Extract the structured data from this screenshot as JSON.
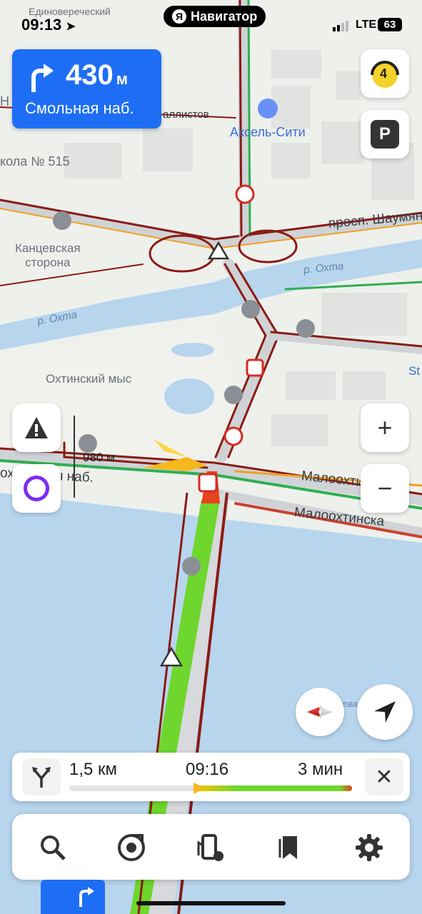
{
  "status_bar": {
    "time": "09:13",
    "network": "LTE",
    "battery": "63"
  },
  "app_pill": {
    "logo": "Я",
    "title": "Навигатор"
  },
  "maneuver": {
    "distance": "430",
    "unit": "м",
    "street": "Смольная наб."
  },
  "map_labels": {
    "district_top": "Единовереческий",
    "school": "кола № 515",
    "street_top": "аллистов",
    "poi": "Аксель-Сити",
    "district": "Канцевская\nсторона",
    "avenue": "просп. Шаумян",
    "river_right": "р. Охта",
    "river_left": "р. Охта",
    "cape": "Охтинский мыс",
    "embankment_left": "охтинская наб.",
    "embankment_right_1": "Малоохтинск",
    "embankment_right_2": "Малоохтинска",
    "distance_marker": "980 м",
    "letter_n": "Н",
    "st_label": "St",
    "nev_label": "Нева"
  },
  "controls": {
    "speed_limit": "4",
    "parking": "P"
  },
  "route": {
    "distance": "1,5 км",
    "arrival": "09:16",
    "duration": "3 мин",
    "progress_fraction": 0.46
  },
  "icons": {
    "close": "close-icon",
    "search": "search-icon",
    "music": "music-icon",
    "fuel": "fuel-icon",
    "bookmarks": "bookmark-icon",
    "settings": "gear-icon"
  },
  "colors": {
    "accent": "#1e6ef5",
    "route_green": "#6fd62e",
    "traffic_red": "#8b1a13",
    "water": "#b8d5ee",
    "alice": "#7b2cf0"
  }
}
